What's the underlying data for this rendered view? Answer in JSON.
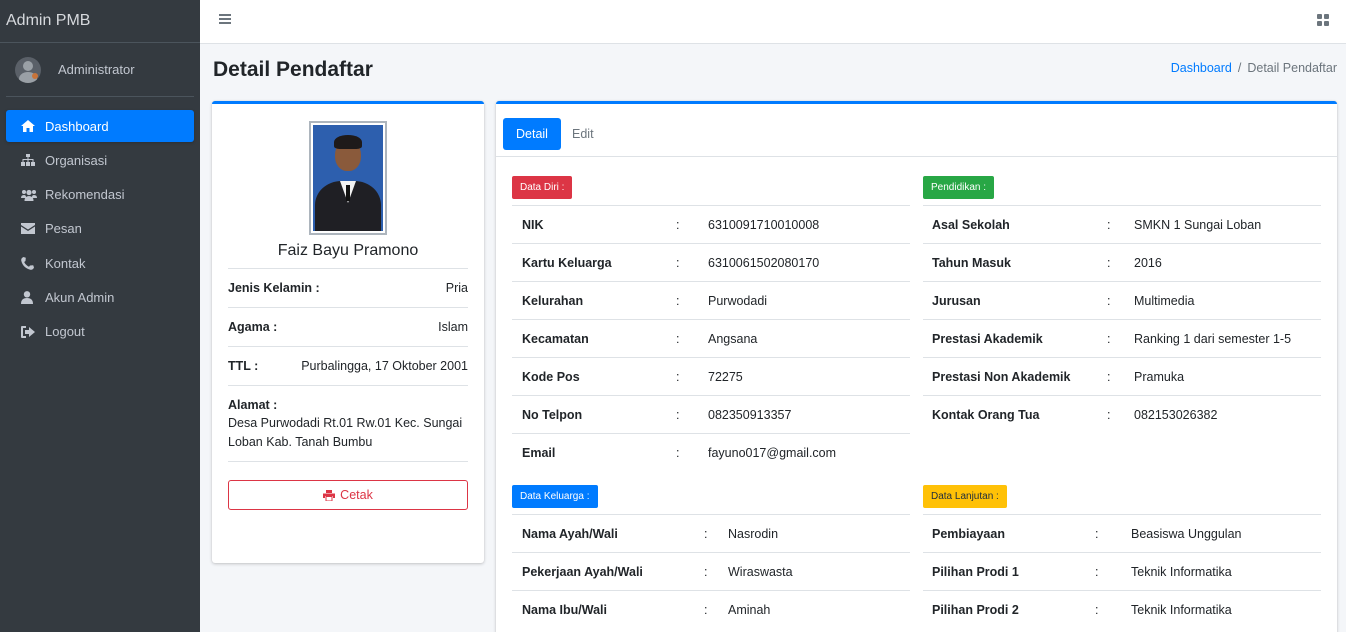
{
  "sidebar": {
    "brand": "Admin PMB",
    "user": "Administrator",
    "items": [
      {
        "label": "Dashboard",
        "icon": "home-icon"
      },
      {
        "label": "Organisasi",
        "icon": "sitemap-icon"
      },
      {
        "label": "Rekomendasi",
        "icon": "users-icon"
      },
      {
        "label": "Pesan",
        "icon": "envelope-icon"
      },
      {
        "label": "Kontak",
        "icon": "phone-icon"
      },
      {
        "label": "Akun Admin",
        "icon": "user-icon"
      },
      {
        "label": "Logout",
        "icon": "sign-out-icon"
      }
    ]
  },
  "header": {
    "title": "Detail Pendaftar",
    "breadcrumb": {
      "link": "Dashboard",
      "separator": "/",
      "current": "Detail Pendaftar"
    }
  },
  "profile": {
    "name": "Faiz Bayu Pramono",
    "gender_label": "Jenis Kelamin :",
    "gender": "Pria",
    "religion_label": "Agama :",
    "religion": "Islam",
    "ttl_label": "TTL :",
    "ttl": "Purbalingga, 17 Oktober 2001",
    "address_label": "Alamat :",
    "address": "Desa Purwodadi Rt.01 Rw.01 Kec. Sungai Loban Kab. Tanah Bumbu",
    "print_label": "Cetak"
  },
  "tabs": [
    {
      "label": "Detail"
    },
    {
      "label": "Edit"
    }
  ],
  "sections": {
    "data_diri": {
      "title": "Data Diri :",
      "rows": [
        {
          "key": "NIK",
          "colon": ":",
          "value": "6310091710010008"
        },
        {
          "key": "Kartu Keluarga",
          "colon": ":",
          "value": "6310061502080170"
        },
        {
          "key": "Kelurahan",
          "colon": ":",
          "value": "Purwodadi"
        },
        {
          "key": "Kecamatan",
          "colon": ":",
          "value": "Angsana"
        },
        {
          "key": "Kode Pos",
          "colon": ":",
          "value": "72275"
        },
        {
          "key": "No Telpon",
          "colon": ":",
          "value": "082350913357"
        },
        {
          "key": "Email",
          "colon": ":",
          "value": "fayuno017@gmail.com"
        }
      ]
    },
    "pendidikan": {
      "title": "Pendidikan :",
      "rows": [
        {
          "key": "Asal Sekolah",
          "colon": ":",
          "value": "SMKN 1 Sungai Loban"
        },
        {
          "key": "Tahun Masuk",
          "colon": ":",
          "value": "2016"
        },
        {
          "key": "Jurusan",
          "colon": ":",
          "value": "Multimedia"
        },
        {
          "key": "Prestasi Akademik",
          "colon": ":",
          "value": "Ranking 1 dari semester 1-5"
        },
        {
          "key": "Prestasi Non Akademik",
          "colon": ":",
          "value": "Pramuka"
        },
        {
          "key": "Kontak Orang Tua",
          "colon": ":",
          "value": "082153026382"
        }
      ]
    },
    "data_keluarga": {
      "title": "Data Keluarga :",
      "rows": [
        {
          "key": "Nama Ayah/Wali",
          "colon": ":",
          "value": "Nasrodin"
        },
        {
          "key": "Pekerjaan Ayah/Wali",
          "colon": ":",
          "value": "Wiraswasta"
        },
        {
          "key": "Nama Ibu/Wali",
          "colon": ":",
          "value": "Aminah"
        }
      ]
    },
    "data_lanjutan": {
      "title": "Data Lanjutan :",
      "rows": [
        {
          "key": "Pembiayaan",
          "colon": ":",
          "value": "Beasiswa Unggulan"
        },
        {
          "key": "Pilihan Prodi 1",
          "colon": ":",
          "value": "Teknik Informatika"
        },
        {
          "key": "Pilihan Prodi 2",
          "colon": ":",
          "value": "Teknik Informatika"
        }
      ]
    }
  },
  "colors": {
    "sidebar_bg": "#343a40",
    "primary": "#007bff",
    "danger": "#dc3545",
    "success": "#28a745",
    "warning": "#ffc107"
  }
}
